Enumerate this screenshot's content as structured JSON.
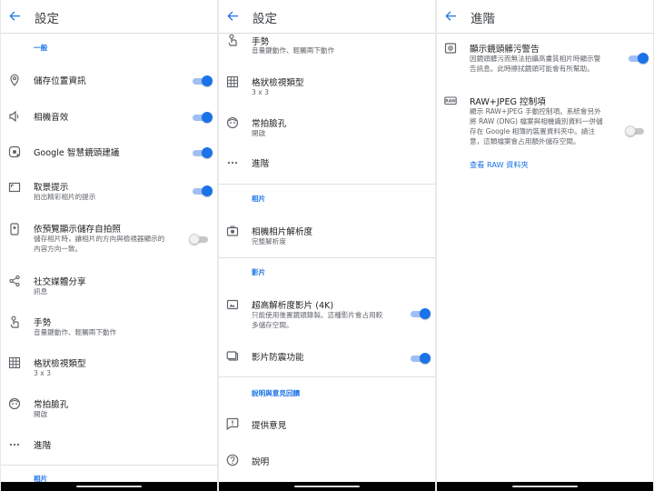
{
  "colors": {
    "accent": "#1a73e8",
    "toggle_track": "#9fbef5",
    "divider": "#e0e0e0"
  },
  "panel1": {
    "title": "設定",
    "section_general": "一般",
    "items": [
      {
        "label": "儲存位置資訊",
        "icon": "location-pin-icon",
        "toggle": true
      },
      {
        "label": "相機音效",
        "icon": "speaker-icon",
        "toggle": true
      },
      {
        "label": "Google 智慧鏡頭建議",
        "icon": "lens-icon",
        "toggle": true
      },
      {
        "label": "取景提示",
        "sub": "拍出精彩相片的提示",
        "icon": "framing-icon",
        "toggle": true
      },
      {
        "label": "依預覽顯示儲存自拍照",
        "sub1": "儲存相片時，讓相片的方向與檢視器顯示的",
        "sub2": "內容方向一致。",
        "icon": "selfie-icon",
        "toggle": false
      },
      {
        "label": "社交媒體分享",
        "sub": "訊息",
        "icon": "share-icon"
      },
      {
        "label": "手勢",
        "sub": "音量鍵動作、輕觸兩下動作",
        "icon": "gesture-icon"
      },
      {
        "label": "格狀檢視類型",
        "sub": "3 x 3",
        "icon": "grid-icon"
      },
      {
        "label": "常拍臉孔",
        "sub": "開啟",
        "icon": "face-icon"
      },
      {
        "label": "進階",
        "icon": "more-icon"
      }
    ],
    "section_photo_cut": "相片"
  },
  "panel2": {
    "title": "設定",
    "items": [
      {
        "label": "手勢",
        "sub": "音量鍵動作、輕觸兩下動作",
        "icon": "gesture-icon"
      },
      {
        "label": "格狀檢視類型",
        "sub": "3 x 3",
        "icon": "grid-icon"
      },
      {
        "label": "常拍臉孔",
        "sub": "開啟",
        "icon": "face-icon"
      },
      {
        "label": "進階",
        "icon": "more-icon"
      }
    ],
    "section_photo": "相片",
    "photo_resolution": {
      "label": "相機相片解析度",
      "sub": "完整解析度",
      "icon": "camera-icon"
    },
    "section_video": "影片",
    "video_4k": {
      "label": "超高解析度影片 (4K)",
      "sub1": "只能使用後置鏡頭錄製。這種影片會占用較",
      "sub2": "多儲存空間。",
      "icon": "video-4k-icon",
      "toggle": true
    },
    "stabilization": {
      "label": "影片防震功能",
      "icon": "stabilization-icon",
      "toggle": true
    },
    "section_help": "說明與意見回饋",
    "feedback": {
      "label": "提供意見",
      "icon": "feedback-icon"
    },
    "help": {
      "label": "說明",
      "icon": "help-icon"
    }
  },
  "panel3": {
    "title": "進階",
    "smudge": {
      "label": "顯示鏡頭髒污警告",
      "sub1": "因鏡頭髒污而無法拍攝高畫質相片時顯示警",
      "sub2": "告訊息。此時擦拭鏡頭可能會有所幫助。",
      "icon": "lens-warning-icon",
      "toggle": true
    },
    "raw": {
      "label": "RAW+JPEG 控制項",
      "sub1": "顯示 RAW+JPEG 手動控制項。系統會另外",
      "sub2": "將 RAW (DNG) 檔案與相機識別資料一併儲",
      "sub3": "存在 Google 相簿的裝置資料夾中。請注",
      "sub4": "意，這類檔案會占用額外儲存空間。",
      "icon": "raw-icon",
      "toggle": false
    },
    "raw_link": "查看 RAW 資料夾"
  }
}
